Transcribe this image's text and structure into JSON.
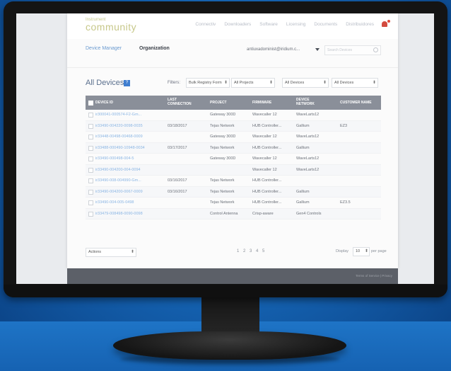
{
  "brand": {
    "line1": "Instrument",
    "line2": "community"
  },
  "topnav": [
    "Connectiv",
    "Downloaders",
    "Software",
    "Licensing",
    "Documents",
    "Distribuidores"
  ],
  "subnav": {
    "tab1": "Device Manager",
    "tab2": "Organization"
  },
  "user": {
    "email": "antiuxadominist@iridium.c..."
  },
  "search": {
    "placeholder": "Search Devices"
  },
  "main": {
    "title": "All Devices",
    "help": "?"
  },
  "filters": {
    "label": "Filters:",
    "options": [
      "Bulk Registry Form",
      "All Projects",
      "All Devices",
      "All Devices"
    ]
  },
  "table": {
    "headers": [
      "DEVICE ID",
      "LAST CONNECTION",
      "PROJECT",
      "FIRMWARE",
      "DEVICE NETWORK",
      "CUSTOMER NAME"
    ],
    "rows": [
      [
        "ir300041-000574-F2-Gm...",
        "",
        "Gateway 300D",
        "Wavecaller 12",
        "WaveLarts12",
        ""
      ],
      [
        "ir33490-004220-0098-0035",
        "03/18/2017",
        "Tejas Network",
        "HUB Controller...",
        "Gallium",
        "EZ3"
      ],
      [
        "ir33448-00498-00468-0009",
        "",
        "Gateway 300D",
        "Wavecaller 12",
        "WaveLarts12",
        ""
      ],
      [
        "ir33488-000490-10948-0034",
        "03/17/2017",
        "Tejas Network",
        "HUB Controller...",
        "Gallium",
        ""
      ],
      [
        "ir33490-000498-004-5",
        "",
        "Gateway 300D",
        "Wavecaller 12",
        "WaveLarts12",
        ""
      ],
      [
        "ir33490-004200-004-0094",
        "",
        "",
        "Wavecaller 12",
        "WaveLarts12",
        ""
      ],
      [
        "ir33490-008-004990-Gm...",
        "03/16/2017",
        "Tejas Network",
        "HUB Controller...",
        "",
        ""
      ],
      [
        "ir33490-004200-0067-0009",
        "03/16/2017",
        "Tejas Network",
        "HUB Controller...",
        "Gallium",
        ""
      ],
      [
        "ir33490-004-005-0498",
        "",
        "Tejas Network",
        "HUB Controller...",
        "Gallium",
        "EZ3.5"
      ],
      [
        "ir33479-008498-0090-0098",
        "",
        "Control Antenna",
        "Crisp-aware",
        "Gen4 Controls",
        ""
      ]
    ]
  },
  "bottom": {
    "actions": "Actions",
    "pager": "1 2 3 4 5",
    "display": "Display",
    "per_value": "10",
    "per_page": "per page"
  },
  "footer": {
    "text": "Terms of Service | Privacy"
  },
  "colors": {
    "accent": "#3f7ed0",
    "header": "#8a8f99",
    "background": "#1564b4"
  }
}
